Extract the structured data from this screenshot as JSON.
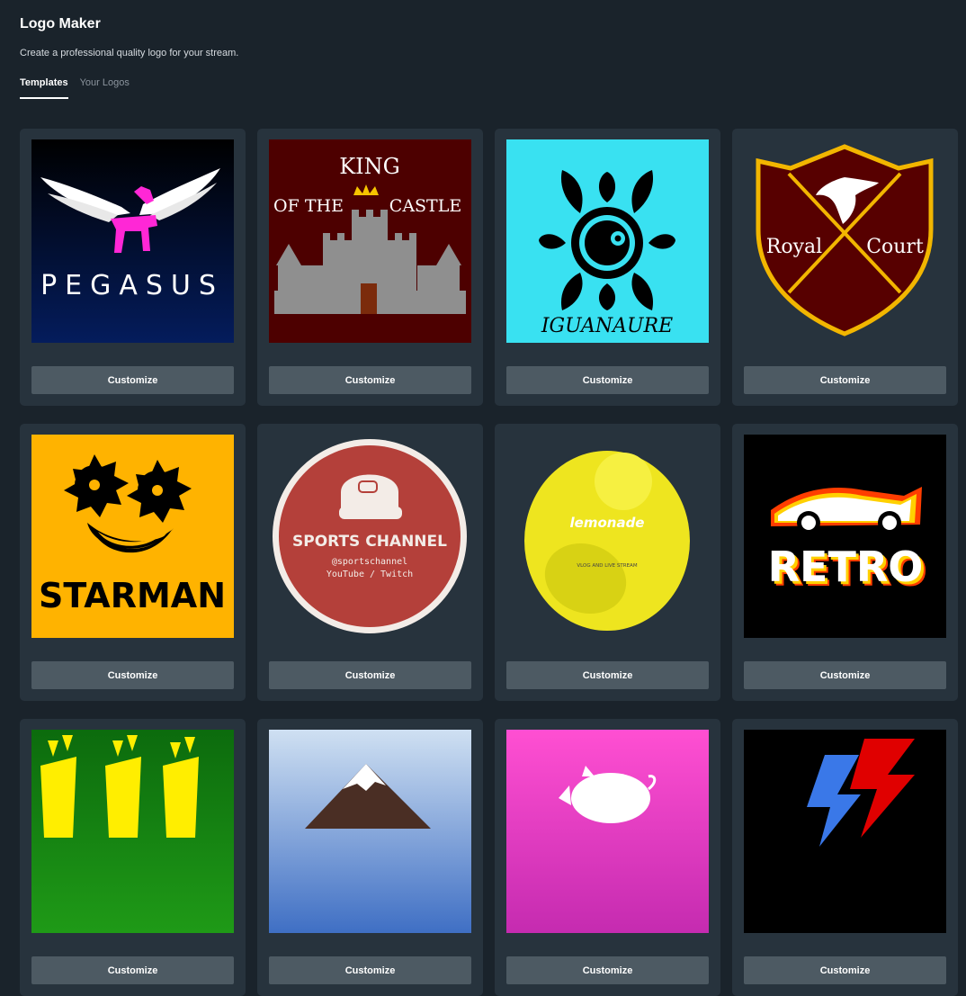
{
  "header": {
    "title": "Logo Maker",
    "subtitle": "Create a professional quality logo for your stream."
  },
  "tabs": [
    {
      "label": "Templates",
      "active": true
    },
    {
      "label": "Your Logos",
      "active": false
    }
  ],
  "cards": [
    {
      "name": "pegasus",
      "logo_text": "PEGASUS",
      "button": "Customize",
      "icon": "winged-horse-icon",
      "colors": {
        "bg_top": "#000000",
        "bg_bottom": "#041c5c",
        "accent": "#ff27d6"
      }
    },
    {
      "name": "king-of-the-castle",
      "logo_text": [
        "KING",
        "OF THE",
        "CASTLE"
      ],
      "button": "Customize",
      "icon": "castle-icon",
      "colors": {
        "bg": "#4d0000",
        "accent": "#8f8f8f"
      }
    },
    {
      "name": "iguanaure",
      "logo_text": "IGUANAURE",
      "button": "Customize",
      "icon": "chameleon-icon",
      "colors": {
        "bg": "#39e1f1",
        "accent": "#000000"
      }
    },
    {
      "name": "royal-court",
      "logo_text": [
        "Royal",
        "Court"
      ],
      "button": "Customize",
      "icon": "shield-swords-icon",
      "colors": {
        "bg": "#27333d",
        "shield": "#570000",
        "accent": "#f2b600"
      }
    },
    {
      "name": "starman",
      "logo_text": "STARMAN",
      "button": "Customize",
      "icon": "star-face-icon",
      "colors": {
        "bg": "#ffb300",
        "accent": "#000000"
      }
    },
    {
      "name": "sports-channel",
      "logo_text": [
        "SPORTS CHANNEL",
        "@sportschannel",
        "YouTube / Twitch"
      ],
      "button": "Customize",
      "icon": "cap-icon",
      "colors": {
        "bg": "#27333d",
        "circle": "#b4403a",
        "ring": "#f3ece7"
      }
    },
    {
      "name": "lemonade",
      "logo_text": [
        "lemonade",
        "VLOG AND LIVE STREAM"
      ],
      "button": "Customize",
      "icon": "lemon-icon",
      "colors": {
        "bg": "#27333d",
        "accent": "#eee51f"
      }
    },
    {
      "name": "retro",
      "logo_text": "RETRO",
      "button": "Customize",
      "icon": "race-car-icon",
      "colors": {
        "bg": "#000000",
        "accent": "#ff3d00"
      }
    },
    {
      "name": "fries",
      "logo_text": "",
      "button": "Customize",
      "icon": "fries-icon",
      "colors": {
        "bg": "#0c6b0d",
        "accent": "#ffee00"
      }
    },
    {
      "name": "mountain",
      "logo_text": "",
      "button": "Customize",
      "icon": "mountain-icon",
      "colors": {
        "bg": "#6f95d8"
      }
    },
    {
      "name": "pig",
      "logo_text": "",
      "button": "Customize",
      "icon": "pig-icon",
      "colors": {
        "bg": "#ff4fd2"
      }
    },
    {
      "name": "lightning",
      "logo_text": "",
      "button": "Customize",
      "icon": "lightning-icon",
      "colors": {
        "bg": "#000000",
        "accent": "#e00000"
      }
    }
  ]
}
